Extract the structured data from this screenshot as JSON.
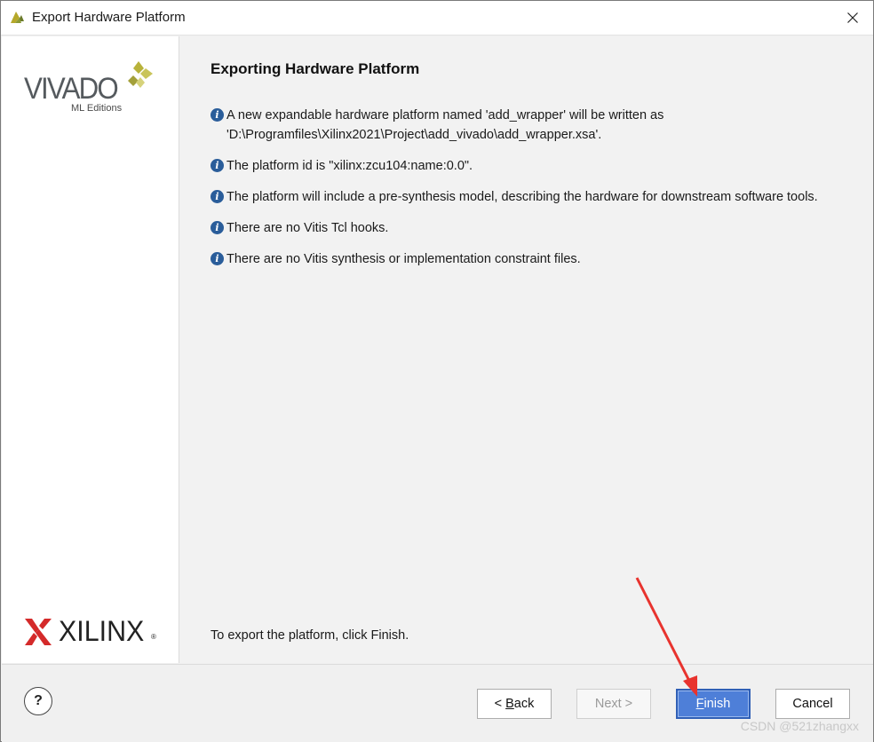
{
  "window": {
    "title": "Export Hardware Platform"
  },
  "sidebar": {
    "vivado_word": "VIVADO",
    "vivado_sub": "ML Editions",
    "xilinx_word": "XILINX",
    "xilinx_reg": "®"
  },
  "main": {
    "heading": "Exporting Hardware Platform",
    "info": [
      {
        "lines": [
          "A new expandable hardware platform named 'add_wrapper' will be written as",
          "'D:\\Programfiles\\Xilinx2021\\Project\\add_vivado\\add_wrapper.xsa'."
        ]
      },
      {
        "lines": [
          "The platform id is \"xilinx:zcu104:name:0.0\"."
        ]
      },
      {
        "lines": [
          "The platform will include a pre-synthesis model, describing the hardware for downstream software tools."
        ]
      },
      {
        "lines": [
          "There are no Vitis Tcl hooks."
        ]
      },
      {
        "lines": [
          "There are no Vitis synthesis or implementation constraint files."
        ]
      }
    ],
    "footer": "To export the platform, click Finish."
  },
  "buttons": {
    "help": "?",
    "back_prefix": "< ",
    "back_mnemonic": "B",
    "back_rest": "ack",
    "next": "Next >",
    "finish_mnemonic": "F",
    "finish_rest": "inish",
    "cancel": "Cancel"
  },
  "watermark": "CSDN @521zhangxx",
  "colors": {
    "info_icon": "#2a5d9a",
    "finish_bg": "#4e7fd8",
    "annotation_arrow": "#e8332e"
  }
}
